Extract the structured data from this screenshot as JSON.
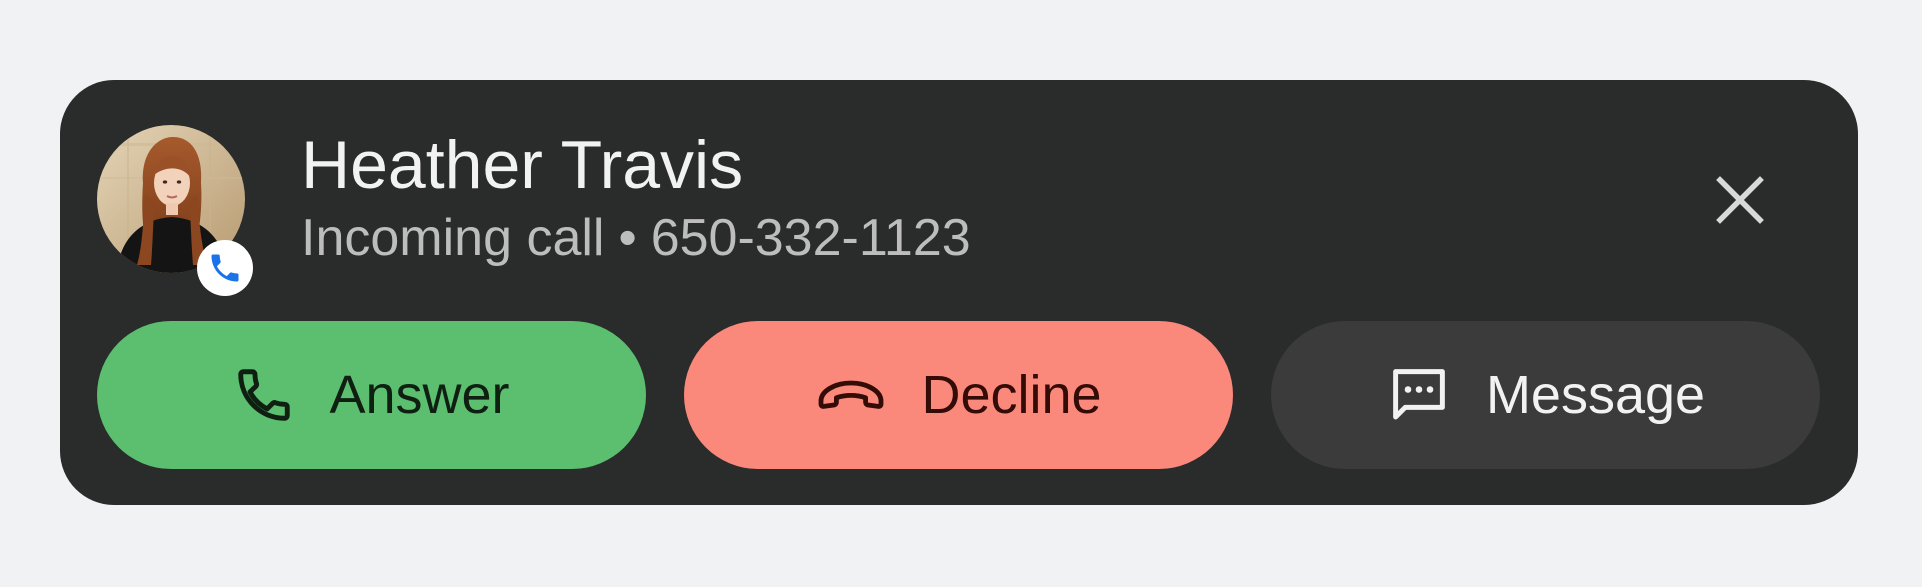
{
  "notification": {
    "caller_name": "Heather Travis",
    "status": "Incoming call",
    "separator": "•",
    "phone_number": "650-332-1123",
    "close_icon": "close-icon",
    "avatar_badge_icon": "phone-icon"
  },
  "actions": {
    "answer_label": "Answer",
    "answer_icon": "phone-icon",
    "decline_label": "Decline",
    "decline_icon": "hang-up-icon",
    "message_label": "Message",
    "message_icon": "message-icon"
  },
  "colors": {
    "background": "#f1f2f4",
    "card": "#2a2b2b",
    "answer": "#5bbf6f",
    "decline": "#fa887b",
    "message": "#3a3b3a",
    "badge_accent": "#1a73e8"
  }
}
